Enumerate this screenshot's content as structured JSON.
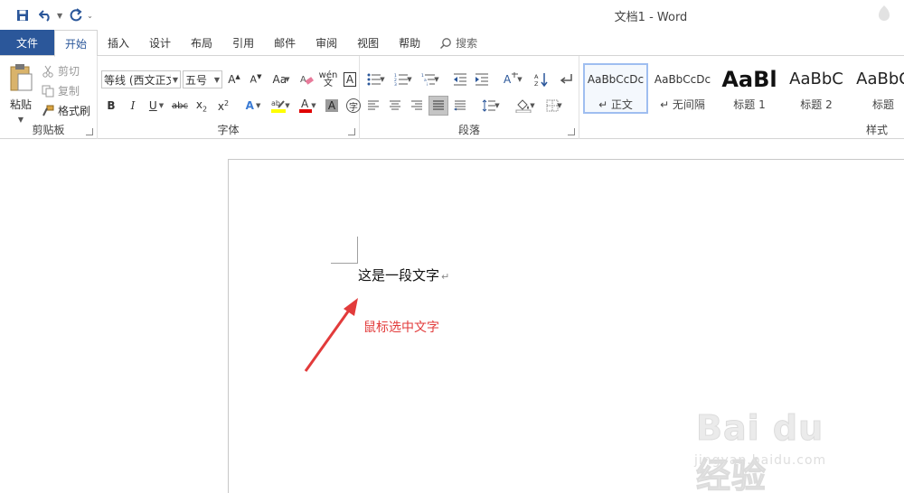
{
  "window": {
    "title": "文档1 - Word"
  },
  "tabs": [
    {
      "label": "文件",
      "kind": "file"
    },
    {
      "label": "开始",
      "kind": "active"
    },
    {
      "label": "插入"
    },
    {
      "label": "设计"
    },
    {
      "label": "布局"
    },
    {
      "label": "引用"
    },
    {
      "label": "邮件"
    },
    {
      "label": "审阅"
    },
    {
      "label": "视图"
    },
    {
      "label": "帮助"
    }
  ],
  "search": {
    "label": "搜索"
  },
  "clipboard": {
    "paste": "粘贴",
    "cut": "剪切",
    "copy": "复制",
    "format_painter": "格式刷",
    "group_label": "剪贴板"
  },
  "font": {
    "name": "等线 (西文正文",
    "size": "五号",
    "group_label": "字体"
  },
  "paragraph": {
    "group_label": "段落"
  },
  "styles": {
    "group_label": "样式",
    "items": [
      {
        "sample": "AaBbCcDc",
        "name": "↵ 正文",
        "selected": true
      },
      {
        "sample": "AaBbCcDc",
        "name": "↵ 无间隔"
      },
      {
        "sample": "AaBl",
        "name": "标题 1"
      },
      {
        "sample": "AaBbC",
        "name": "标题 2"
      },
      {
        "sample": "AaBbC",
        "name": "标题"
      }
    ]
  },
  "document": {
    "text": "这是一段文字",
    "para_mark": "↵",
    "annotation": "鼠标选中文字"
  },
  "watermark": {
    "main": "Bai du 经验",
    "sub": "jingyan.baidu.com"
  },
  "colors": {
    "file_tab": "#2b579a",
    "accent": "#2b579a",
    "annotation": "#e23b3b",
    "font_color_bar": "#e00000",
    "highlight_bar": "#ffff00"
  }
}
